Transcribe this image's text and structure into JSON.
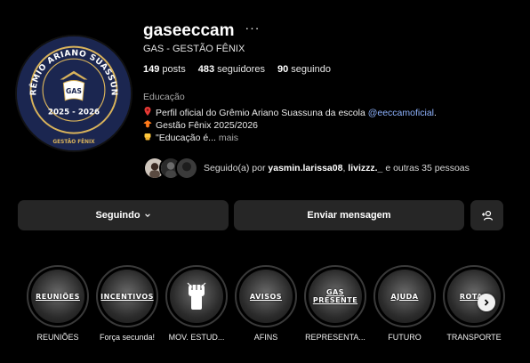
{
  "profile": {
    "username": "gaseeccam",
    "more_label": "···",
    "full_name": "GAS - GESTÃO FÊNIX",
    "category": "Educação",
    "avatar_logo": {
      "arc_text": "GRÊMIO ARIANO SUASSUNA",
      "center": "GAS",
      "years": "2025 - 2026",
      "bottom": "GESTÃO FÊNIX"
    }
  },
  "stats": {
    "posts_count": "149",
    "posts_label": "posts",
    "followers_count": "483",
    "followers_label": "seguidores",
    "following_count": "90",
    "following_label": "seguindo"
  },
  "bio": {
    "line1_icon": "pin-icon",
    "line1_text": "Perfil oficial do Grêmio Ariano Suassuna da escola ",
    "line1_mention": "@eeccamoficial",
    "line1_end": ".",
    "line2_icon": "phoenix-icon",
    "line2_text": "Gestão Fênix 2025/2026",
    "line3_icon": "fist-icon",
    "line3_text": "\"Educação é...",
    "line3_more": " mais"
  },
  "followed_by": {
    "prefix": "Seguido(a) por ",
    "user1": "yasmin.larissa08",
    "sep": ", ",
    "user2": "livizzz._",
    "suffix": " e outras 35 pessoas"
  },
  "buttons": {
    "following": "Seguindo",
    "message": "Enviar mensagem"
  },
  "highlights": [
    {
      "label": "REUNIÕES",
      "cover": "REUNIÕES"
    },
    {
      "label": "Força secunda!",
      "cover": "INCENTIVOS"
    },
    {
      "label": "MOV. ESTUD...",
      "cover": ""
    },
    {
      "label": "AFINS",
      "cover": "AVISOS"
    },
    {
      "label": "REPRESENTA...",
      "cover": "GAS PRESENTE"
    },
    {
      "label": "FUTURO",
      "cover": "AJUDA"
    },
    {
      "label": "TRANSPORTE",
      "cover": "ROTAS"
    }
  ],
  "colors": {
    "background": "#000000",
    "button_bg": "#262626",
    "mention": "#8fb4ff",
    "avatar_navy": "#1b2650",
    "logo_gold": "#d9b35b"
  }
}
